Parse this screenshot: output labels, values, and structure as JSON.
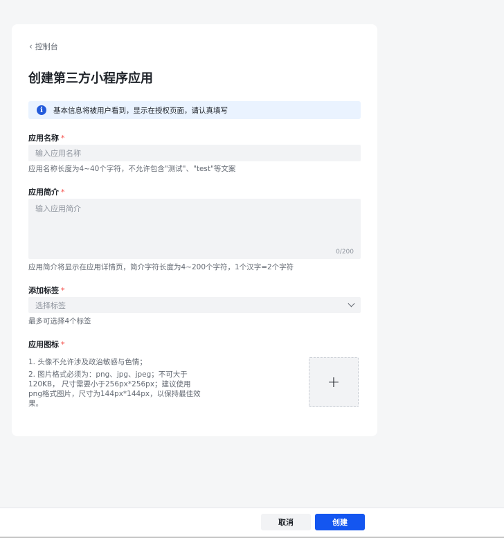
{
  "nav": {
    "back_label": "控制台"
  },
  "page": {
    "title": "创建第三方小程序应用"
  },
  "notice": {
    "text": "基本信息将被用户看到，显示在授权页面，请认真填写"
  },
  "fields": {
    "app_name": {
      "label": "应用名称",
      "required": "*",
      "placeholder": "输入应用名称",
      "help": "应用名称长度为4~40个字符，不允许包含\"测试\"、\"test\"等文案"
    },
    "app_intro": {
      "label": "应用简介",
      "required": "*",
      "placeholder": "输入应用简介",
      "counter": "0/200",
      "help": "应用简介将显示在应用详情页，简介字符长度为4~200个字符，1个汉字=2个字符"
    },
    "tags": {
      "label": "添加标签",
      "required": "*",
      "placeholder": "选择标签",
      "help": "最多可选择4个标签"
    },
    "icon": {
      "label": "应用图标",
      "required": "*",
      "rule_1": "1. 头像不允许涉及政治敏感与色情；",
      "rule_2": "2. 图片格式必须为：png、jpg、jpeg；不可大于120KB， 尺寸需要小于256px*256px；建议使用png格式图片，尺寸为144px*144px，以保持最佳效果。",
      "upload_symbol": "+"
    }
  },
  "footer": {
    "cancel_label": "取消",
    "create_label": "创建"
  },
  "colors": {
    "primary": "#1456f0",
    "required": "#f54a45",
    "notice_bg": "#eaf3ff"
  }
}
